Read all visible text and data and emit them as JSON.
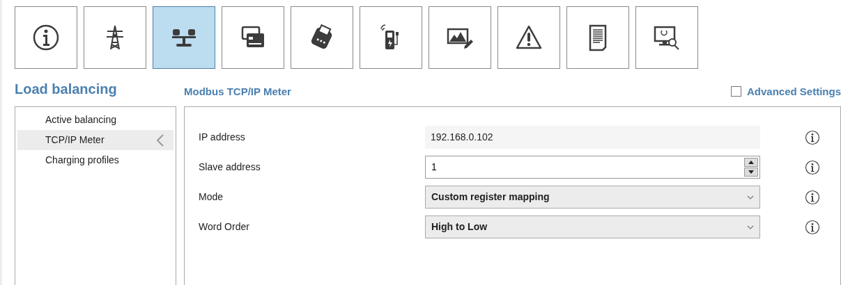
{
  "toolbar": [
    {
      "kind": "info",
      "selected": false
    },
    {
      "kind": "pylon",
      "selected": false
    },
    {
      "kind": "scale",
      "selected": true
    },
    {
      "kind": "cards",
      "selected": false
    },
    {
      "kind": "terminal",
      "selected": false
    },
    {
      "kind": "charger",
      "selected": false
    },
    {
      "kind": "image",
      "selected": false
    },
    {
      "kind": "warning",
      "selected": false
    },
    {
      "kind": "document",
      "selected": false
    },
    {
      "kind": "monitor",
      "selected": false
    }
  ],
  "page_title": "Load balancing",
  "section_title": "Modbus TCP/IP Meter",
  "advanced_settings": {
    "label": "Advanced Settings",
    "checked": false
  },
  "sidebar": {
    "items": [
      {
        "label": "Active balancing",
        "selected": false
      },
      {
        "label": "TCP/IP Meter",
        "selected": true
      },
      {
        "label": "Charging profiles",
        "selected": false
      }
    ]
  },
  "fields": [
    {
      "label": "IP address",
      "kind": "readonly",
      "value": "192.168.0.102"
    },
    {
      "label": "Slave address",
      "kind": "spinner",
      "value": "1"
    },
    {
      "label": "Mode",
      "kind": "dropdown",
      "value": "Custom register mapping"
    },
    {
      "label": "Word Order",
      "kind": "dropdown",
      "value": "High to Low"
    }
  ]
}
